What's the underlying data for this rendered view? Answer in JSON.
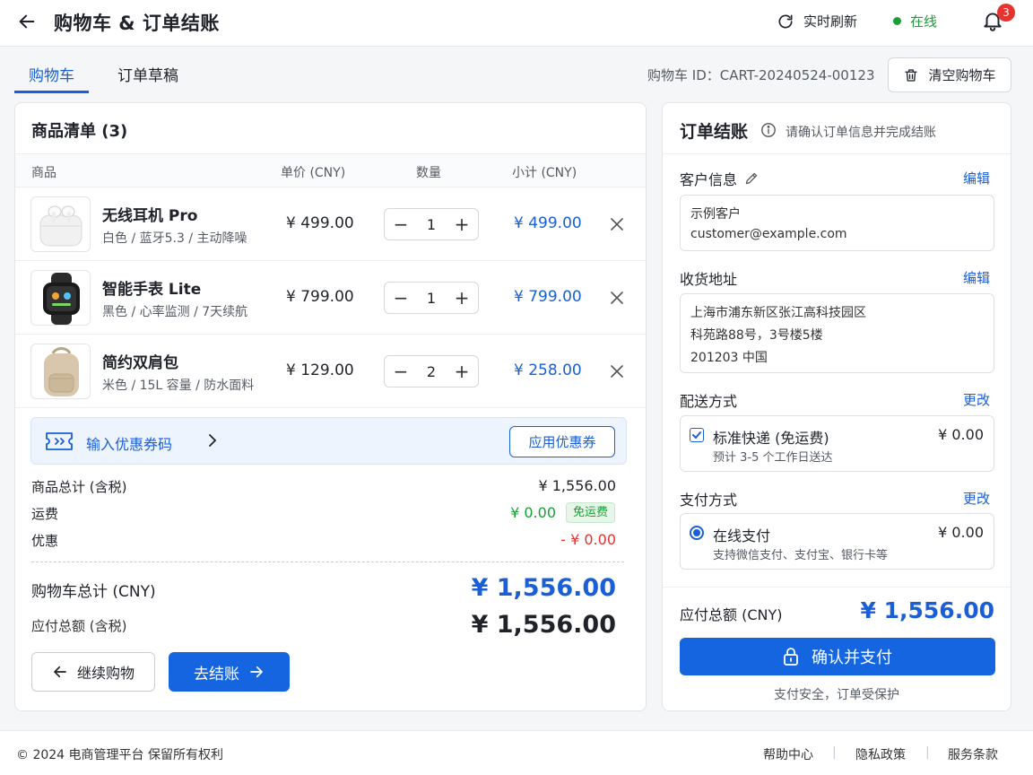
{
  "header": {
    "title": "购物车 & 订单结账",
    "refresh_label": "实时刷新",
    "status_label": "在线",
    "notification_count": "3"
  },
  "tabs": [
    {
      "label": "购物车",
      "active": true
    },
    {
      "label": "订单草稿",
      "active": false
    }
  ],
  "cart_id": "购物车 ID：CART-20240524-00123",
  "clear_cart_label": "清空购物车",
  "cart": {
    "title": "商品清单 (3)",
    "columns": {
      "product": "商品",
      "unit_price": "单价 (CNY)",
      "quantity": "数量",
      "subtotal": "小计 (CNY)"
    },
    "items": [
      {
        "name": "无线耳机 Pro",
        "attrs": "白色 / 蓝牙5.3 / 主动降噪",
        "price": "¥ 499.00",
        "qty": "1",
        "subtotal": "¥ 499.00",
        "icon": "earbuds-icon"
      },
      {
        "name": "智能手表 Lite",
        "attrs": "黑色 / 心率监测 / 7天续航",
        "price": "¥ 799.00",
        "qty": "1",
        "subtotal": "¥ 799.00",
        "icon": "smartwatch-icon"
      },
      {
        "name": "简约双肩包",
        "attrs": "米色 / 15L 容量 / 防水面料",
        "price": "¥ 129.00",
        "qty": "2",
        "subtotal": "¥ 258.00",
        "icon": "backpack-icon"
      }
    ],
    "coupon": {
      "placeholder": "输入优惠券码",
      "apply_label": "应用优惠券"
    },
    "summary": {
      "goods_total_label": "商品总计 (含税)",
      "goods_total": "¥ 1,556.00",
      "shipping_label": "运费",
      "shipping": "¥ 0.00",
      "free_shipping_badge": "免运费",
      "discount_label": "优惠",
      "discount": "- ¥ 0.00",
      "cart_total_label": "购物车总计 (CNY)",
      "cart_total": "¥ 1,556.00",
      "amount_due_label": "应付总额 (含税)",
      "amount_due": "¥ 1,556.00"
    },
    "continue_label": "继续购物",
    "checkout_label": "去结账"
  },
  "checkout": {
    "title": "订单结账",
    "subtitle": "请确认订单信息并完成结账",
    "customer": {
      "label": "客户信息",
      "edit": "编辑",
      "name": "示例客户",
      "email": "customer@example.com"
    },
    "address": {
      "label": "收货地址",
      "edit": "编辑",
      "lines": [
        "上海市浦东新区张江高科技园区",
        "科苑路88号，3号楼5楼",
        "201203 中国"
      ]
    },
    "delivery": {
      "label": "配送方式",
      "change": "更改",
      "option": "标准快递 (免运费)",
      "desc": "预计 3-5 个工作日送达",
      "price": "¥ 0.00"
    },
    "payment": {
      "label": "支付方式",
      "change": "更改",
      "option": "在线支付",
      "desc": "支持微信支付、支付宝、银行卡等",
      "price": "¥ 0.00"
    },
    "amount_due_label": "应付总额 (CNY)",
    "amount_due": "¥ 1,556.00",
    "pay_label": "确认并支付",
    "secure_note": "支付安全，订单受保护"
  },
  "footer": {
    "copyright": "© 2024 电商管理平台 保留所有权利",
    "links": [
      "帮助中心",
      "隐私政策",
      "服务条款"
    ]
  },
  "colors": {
    "accent": "#1565e0",
    "success": "#18a036",
    "danger": "#e5332f"
  }
}
